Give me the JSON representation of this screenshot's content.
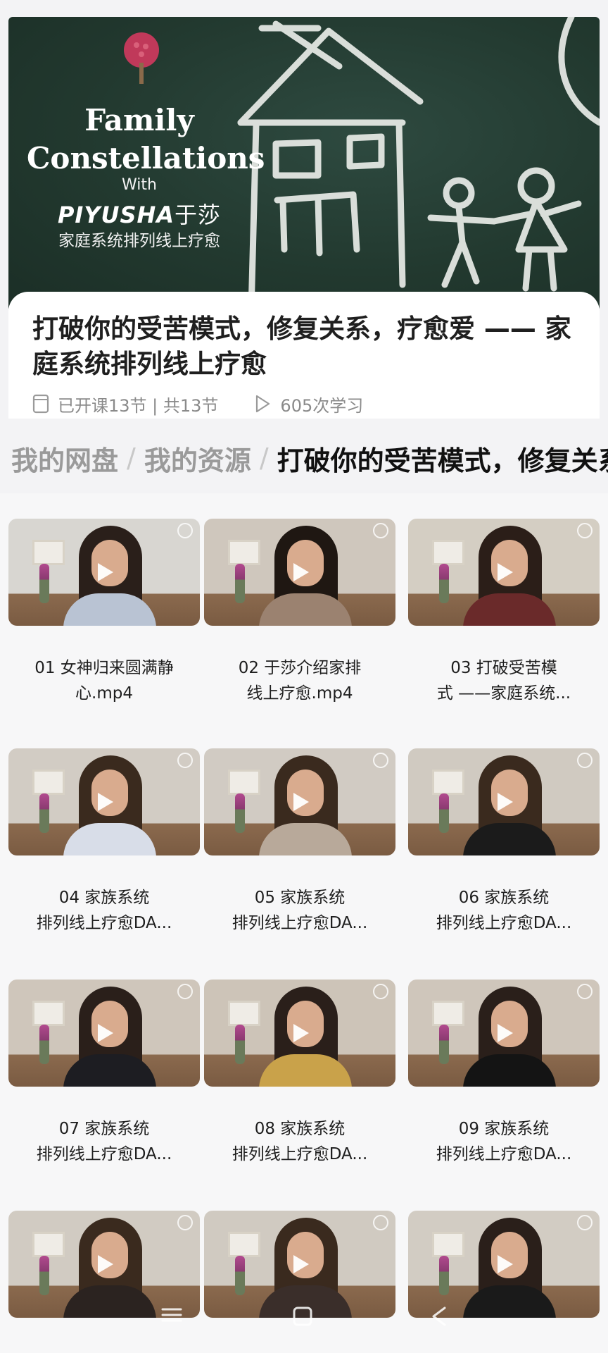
{
  "banner": {
    "title_line1": "Family",
    "title_line2": "Constellations",
    "with": "With",
    "brand": "PIYUSHA",
    "brand_cn": "于莎",
    "subtitle": "家庭系统排列线上疗愈"
  },
  "course": {
    "title": "打破你的受苦模式，修复关系，疗愈爱 —— 家庭系统排列线上疗愈",
    "lessons": "已开课13节 | 共13节",
    "plays": "605次学习"
  },
  "breadcrumb": {
    "root": "我的网盘",
    "folder": "我的资源",
    "current": "打破你的受苦模式，修复关系，疗愈爱"
  },
  "videos": [
    {
      "line1": "01 女神归来圆满静",
      "line2": "心.mp4",
      "top": "#d8d6d1",
      "shirt": "#b9c3d3",
      "hair": "#2a1f1a"
    },
    {
      "line1": "02 于莎介绍家排",
      "line2": "线上疗愈.mp4",
      "top": "#cfc7bd",
      "shirt": "#9b8270",
      "hair": "#1f1712"
    },
    {
      "line1": "03 打破受苦模",
      "line2": "式 ——家庭系统...",
      "top": "#d4cec3",
      "shirt": "#6a2a2a",
      "hair": "#2b1e18"
    },
    {
      "line1": "04 家族系统",
      "line2": "排列线上疗愈DA...",
      "top": "#d2ccc4",
      "shirt": "#d8dde8",
      "hair": "#3a2a1e"
    },
    {
      "line1": "05 家族系统",
      "line2": "排列线上疗愈DA...",
      "top": "#d1cbc3",
      "shirt": "#b8a99a",
      "hair": "#3a2a1e"
    },
    {
      "line1": "06 家族系统",
      "line2": "排列线上疗愈DA...",
      "top": "#d0cac1",
      "shirt": "#1b1b1b",
      "hair": "#3a2a1e"
    },
    {
      "line1": "07 家族系统",
      "line2": "排列线上疗愈DA...",
      "top": "#cfc6bb",
      "shirt": "#1d1d22",
      "hair": "#2a1f1a"
    },
    {
      "line1": "08 家族系统",
      "line2": "排列线上疗愈DA...",
      "top": "#cdc4b8",
      "shirt": "#c9a24a",
      "hair": "#2a1f1a"
    },
    {
      "line1": "09 家族系统",
      "line2": "排列线上疗愈DA...",
      "top": "#cfc6bb",
      "shirt": "#141414",
      "hair": "#2a1f1a"
    },
    {
      "line1": "",
      "line2": "",
      "top": "#d1cbc2",
      "shirt": "#2b2320",
      "hair": "#3a2a1e"
    },
    {
      "line1": "",
      "line2": "",
      "top": "#d0cac1",
      "shirt": "#3a2e2a",
      "hair": "#3a2a1e"
    },
    {
      "line1": "",
      "line2": "",
      "top": "#d2ccc3",
      "shirt": "#1a1a1a",
      "hair": "#2a1f1a"
    }
  ],
  "colors": {
    "chalkboard": "#22392f",
    "chalk": "#e9ece8",
    "logo_tree": "#c0395a"
  }
}
